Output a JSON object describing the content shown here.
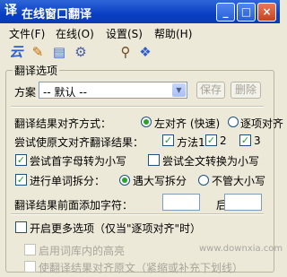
{
  "window": {
    "title": "在线窗口翻译",
    "icon": "translate-app-icon",
    "controls": {
      "minimize": "_",
      "maximize": "□",
      "close": "×"
    }
  },
  "menu": {
    "file": "文件(F)",
    "online": "在线(O)",
    "settings": "设置(S)",
    "help": "帮助(H)"
  },
  "toolbar": {
    "icons": [
      "translate-icon",
      "edit-icon",
      "document-icon",
      "gear-icon",
      "search-icon",
      "help-icon"
    ]
  },
  "options": {
    "group_title": "翻译选项",
    "scheme": {
      "label": "方案",
      "value": "-- 默认 --",
      "save": "保存",
      "delete": "删除"
    },
    "align": {
      "label": "翻译结果对齐方式：",
      "left": "左对齐 (快速)",
      "item": "逐项对齐",
      "selected": "left"
    },
    "methods": {
      "label": "尝试使原文对齐翻译结果：",
      "m1": "方法1",
      "m2": "2",
      "m3": "3",
      "m1_checked": true,
      "m2_checked": true,
      "m3_checked": true
    },
    "first_lower": {
      "label": "尝试首字母转为小写",
      "checked": true
    },
    "all_lower": {
      "label": "尝试全文转换为小写",
      "checked": false
    },
    "split": {
      "label": "进行单词拆分：",
      "upper": "遇大写拆分",
      "ignore": "不管大小写",
      "checked": true,
      "selected": "upper"
    },
    "prefix": {
      "label": "翻译结果前面添加字符：",
      "after_label": "后面:"
    },
    "more": {
      "label": "开启更多选项（仅当\"逐项对齐\"时）",
      "checked": false
    },
    "dict_hl": {
      "label": "启用词库内的高亮"
    },
    "underline": {
      "label": "使翻译结果对齐原文（紧缩或补充下划线）"
    }
  },
  "watermark": "www.downxia.com"
}
